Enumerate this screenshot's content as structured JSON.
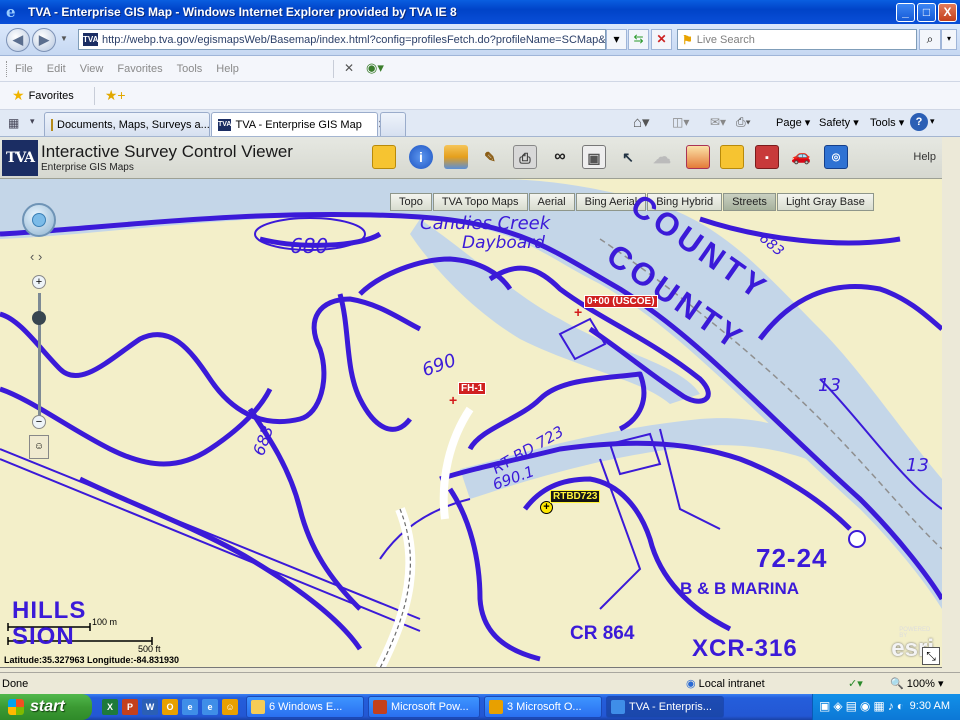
{
  "window": {
    "title": "TVA - Enterprise GIS Map - Windows Internet Explorer provided by TVA IE 8",
    "minimize": "_",
    "maximize": "□",
    "close": "X"
  },
  "address_bar": {
    "url": "http://webp.tva.gov/egismapsWeb/Basemap/index.html?config=profilesFetch.do?profileName=SCMap&request",
    "search_placeholder": "Live Search"
  },
  "menu": {
    "items": [
      "File",
      "Edit",
      "View",
      "Favorites",
      "Tools",
      "Help"
    ]
  },
  "favorites_bar": {
    "label": "Favorites"
  },
  "tabs": [
    {
      "label": "Documents, Maps, Surveys a..."
    },
    {
      "label": "TVA - Enterprise GIS Map"
    }
  ],
  "command_bar": {
    "page": "Page ▾",
    "safety": "Safety ▾",
    "tools": "Tools ▾"
  },
  "app": {
    "logo": "TVA",
    "title": "Interactive Survey Control Viewer",
    "subtitle": "Enterprise GIS Maps",
    "help": "Help",
    "toolbar_icons": [
      "folder-icon",
      "info-icon",
      "layers-icon",
      "measure-icon",
      "print-icon",
      "binoculars-icon",
      "identify-icon",
      "pointer-icon",
      "cloud-icon",
      "chart-icon",
      "folder-open-icon",
      "save-icon",
      "vehicle-icon",
      "share-icon"
    ]
  },
  "basemaps": [
    {
      "label": "Topo"
    },
    {
      "label": "TVA Topo Maps"
    },
    {
      "label": "Aerial"
    },
    {
      "label": "Bing Aerial"
    },
    {
      "label": "Bing Hybrid"
    },
    {
      "label": "Streets"
    },
    {
      "label": "Light Gray Base"
    }
  ],
  "map": {
    "markers": [
      {
        "label": "0+00 (USCOE)"
      },
      {
        "label": "FH-1"
      },
      {
        "label": "RTBD723"
      }
    ],
    "topo_text": {
      "candies": "Candies Creek",
      "dayboard": "Dayboard",
      "c680": "680",
      "c683a": "683",
      "c683b": "683",
      "c690": "690",
      "rtbd": "RT BD 723",
      "elev": "690.1",
      "county1": "COUNTY",
      "county2": "COUNTY",
      "mile": "72-24",
      "marina": "B & B MARINA",
      "cr864": "CR 864",
      "xcr": "XCR-316",
      "hills": "HILLS",
      "sion": "SION",
      "thirteen1": "13",
      "thirteen2": "13"
    },
    "scale": {
      "m": "100 m",
      "ft": "500 ft"
    },
    "coords": "Latitude:35.327963    Longitude:-84.831930",
    "esri": "esri",
    "powered": "POWERED BY"
  },
  "status": {
    "text": "Done",
    "zone": "Local intranet",
    "zoom": "100%"
  },
  "taskbar": {
    "start": "start",
    "tasks": [
      {
        "label": "6 Windows E..."
      },
      {
        "label": "Microsoft Pow..."
      },
      {
        "label": "3 Microsoft O..."
      },
      {
        "label": "TVA - Enterpris..."
      }
    ],
    "clock": "9:30 AM"
  },
  "colors": {
    "contour": "#3b1ad8",
    "water": "#c4d6e8",
    "land": "#f3efc9",
    "marker": "#d31b1b"
  }
}
